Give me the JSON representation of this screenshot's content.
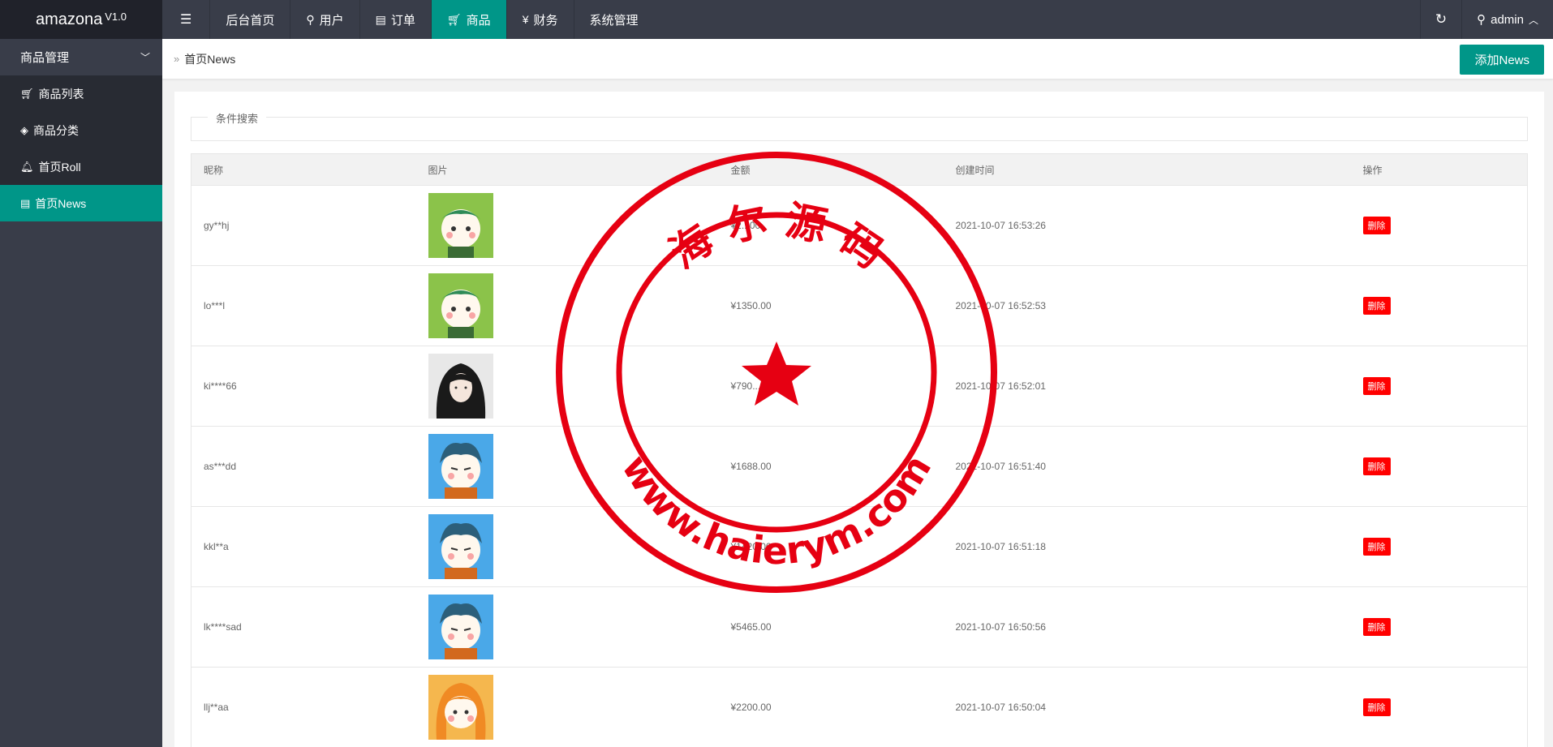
{
  "app": {
    "name": "amazona",
    "version": "V1.0"
  },
  "topnav": [
    {
      "label": "",
      "icon": "menu-icon"
    },
    {
      "label": "后台首页"
    },
    {
      "label": "用户",
      "icon": "user-icon"
    },
    {
      "label": "订单",
      "icon": "document-icon"
    },
    {
      "label": "商品",
      "icon": "cart-icon",
      "active": true
    },
    {
      "label": "财务",
      "icon": "yen-icon"
    },
    {
      "label": "系统管理"
    }
  ],
  "topright": {
    "user": "admin"
  },
  "sidebar": {
    "group": "商品管理",
    "items": [
      {
        "label": "商品列表",
        "icon": "cart-icon"
      },
      {
        "label": "商品分类",
        "icon": "layers-icon"
      },
      {
        "label": "首页Roll",
        "icon": "bell-icon"
      },
      {
        "label": "首页News",
        "icon": "news-icon",
        "active": true
      }
    ]
  },
  "breadcrumb": {
    "label": "首页News"
  },
  "add_button": "添加News",
  "search": {
    "legend": "条件搜索"
  },
  "table": {
    "headers": [
      "昵称",
      "图片",
      "金额",
      "创建时间",
      "操作"
    ],
    "rows": [
      {
        "name": "gy**hj",
        "avatar": "green-hair-cat",
        "amount": "¥2...00",
        "time": "2021-10-07 16:53:26",
        "action": "删除"
      },
      {
        "name": "lo***l",
        "avatar": "green-hair-cat",
        "amount": "¥1350.00",
        "time": "2021-10-07 16:52:53",
        "action": "删除"
      },
      {
        "name": "ki****66",
        "avatar": "dark-hair-man",
        "amount": "¥790...",
        "time": "2021-10-07 16:52:01",
        "action": "删除"
      },
      {
        "name": "as***dd",
        "avatar": "blue-cat",
        "amount": "¥1688.00",
        "time": "2021-10-07 16:51:40",
        "action": "删除"
      },
      {
        "name": "kkl**a",
        "avatar": "blue-cat",
        "amount": "¥1420.00",
        "time": "2021-10-07 16:51:18",
        "action": "删除"
      },
      {
        "name": "lk****sad",
        "avatar": "blue-cat",
        "amount": "¥5465.00",
        "time": "2021-10-07 16:50:56",
        "action": "删除"
      },
      {
        "name": "llj**aa",
        "avatar": "orange-hair-girl",
        "amount": "¥2200.00",
        "time": "2021-10-07 16:50:04",
        "action": "删除"
      }
    ]
  },
  "stamp": {
    "top_text": "海 尔 源 码",
    "bottom_text": "www.haierym.com",
    "color": "#e60012"
  },
  "colors": {
    "accent": "#009688",
    "topbar": "#393d49",
    "danger": "#ff0000"
  }
}
